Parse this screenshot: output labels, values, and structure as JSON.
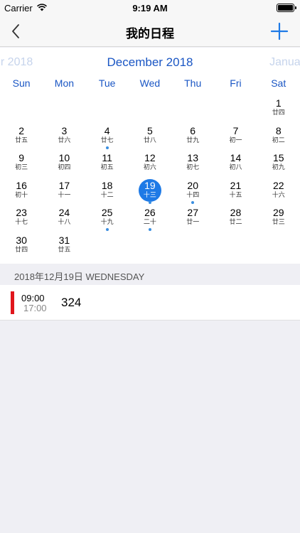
{
  "status": {
    "carrier": "Carrier",
    "time": "9:19 AM"
  },
  "nav": {
    "title": "我的日程"
  },
  "calendar": {
    "prev_month": "er 2018",
    "month": "December 2018",
    "next_month": "Januar",
    "weekdays": [
      "Sun",
      "Mon",
      "Tue",
      "Wed",
      "Thu",
      "Fri",
      "Sat"
    ],
    "leading_blank_days": 6,
    "selected_day": "19",
    "days": [
      {
        "day": "1",
        "lunar": "廿四",
        "dot": false
      },
      {
        "day": "2",
        "lunar": "廿五",
        "dot": false
      },
      {
        "day": "3",
        "lunar": "廿六",
        "dot": false
      },
      {
        "day": "4",
        "lunar": "廿七",
        "dot": true
      },
      {
        "day": "5",
        "lunar": "廿八",
        "dot": false
      },
      {
        "day": "6",
        "lunar": "廿九",
        "dot": false
      },
      {
        "day": "7",
        "lunar": "初一",
        "dot": false
      },
      {
        "day": "8",
        "lunar": "初二",
        "dot": false
      },
      {
        "day": "9",
        "lunar": "初三",
        "dot": false
      },
      {
        "day": "10",
        "lunar": "初四",
        "dot": false
      },
      {
        "day": "11",
        "lunar": "初五",
        "dot": false
      },
      {
        "day": "12",
        "lunar": "初六",
        "dot": false
      },
      {
        "day": "13",
        "lunar": "初七",
        "dot": false
      },
      {
        "day": "14",
        "lunar": "初八",
        "dot": false
      },
      {
        "day": "15",
        "lunar": "初九",
        "dot": false
      },
      {
        "day": "16",
        "lunar": "初十",
        "dot": false
      },
      {
        "day": "17",
        "lunar": "十一",
        "dot": false
      },
      {
        "day": "18",
        "lunar": "十二",
        "dot": false
      },
      {
        "day": "19",
        "lunar": "十三",
        "dot": true
      },
      {
        "day": "20",
        "lunar": "十四",
        "dot": true
      },
      {
        "day": "21",
        "lunar": "十五",
        "dot": false
      },
      {
        "day": "22",
        "lunar": "十六",
        "dot": false
      },
      {
        "day": "23",
        "lunar": "十七",
        "dot": false
      },
      {
        "day": "24",
        "lunar": "十八",
        "dot": false
      },
      {
        "day": "25",
        "lunar": "十九",
        "dot": true
      },
      {
        "day": "26",
        "lunar": "二十",
        "dot": true
      },
      {
        "day": "27",
        "lunar": "廿一",
        "dot": false
      },
      {
        "day": "28",
        "lunar": "廿二",
        "dot": false
      },
      {
        "day": "29",
        "lunar": "廿三",
        "dot": false
      },
      {
        "day": "30",
        "lunar": "廿四",
        "dot": false
      },
      {
        "day": "31",
        "lunar": "廿五",
        "dot": false
      }
    ]
  },
  "selected_date_label": "2018年12月19日 WEDNESDAY",
  "events": [
    {
      "start": "09:00",
      "end": "17:00",
      "title": "324",
      "color": "#e0161c"
    }
  ],
  "colors": {
    "accent": "#1e7ae6",
    "month_text": "#1a56c4",
    "event_dot": "#3a8ee0"
  }
}
